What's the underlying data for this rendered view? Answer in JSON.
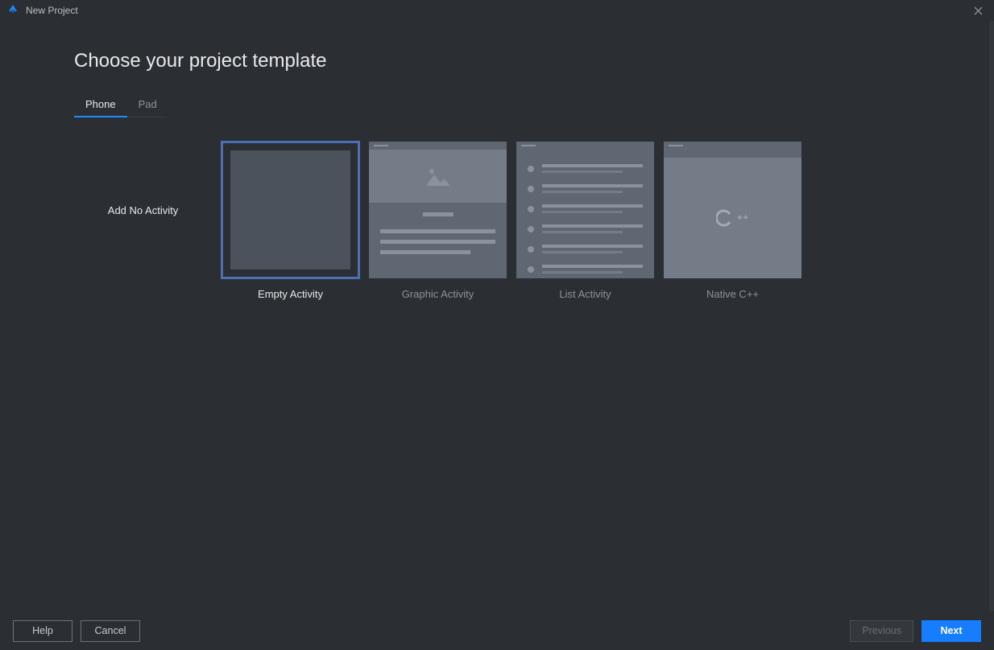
{
  "window": {
    "title": "New Project"
  },
  "heading": "Choose your project template",
  "tabs": {
    "phone": "Phone",
    "pad": "Pad",
    "active": "phone"
  },
  "templates": {
    "add_no_activity": {
      "label": "Add No Activity"
    },
    "empty_activity": {
      "label": "Empty Activity",
      "selected": true
    },
    "graphic_activity": {
      "label": "Graphic Activity"
    },
    "list_activity": {
      "label": "List Activity"
    },
    "native_cpp": {
      "label": "Native C++",
      "badge": "++"
    }
  },
  "footer": {
    "help": "Help",
    "cancel": "Cancel",
    "previous": "Previous",
    "next": "Next"
  }
}
